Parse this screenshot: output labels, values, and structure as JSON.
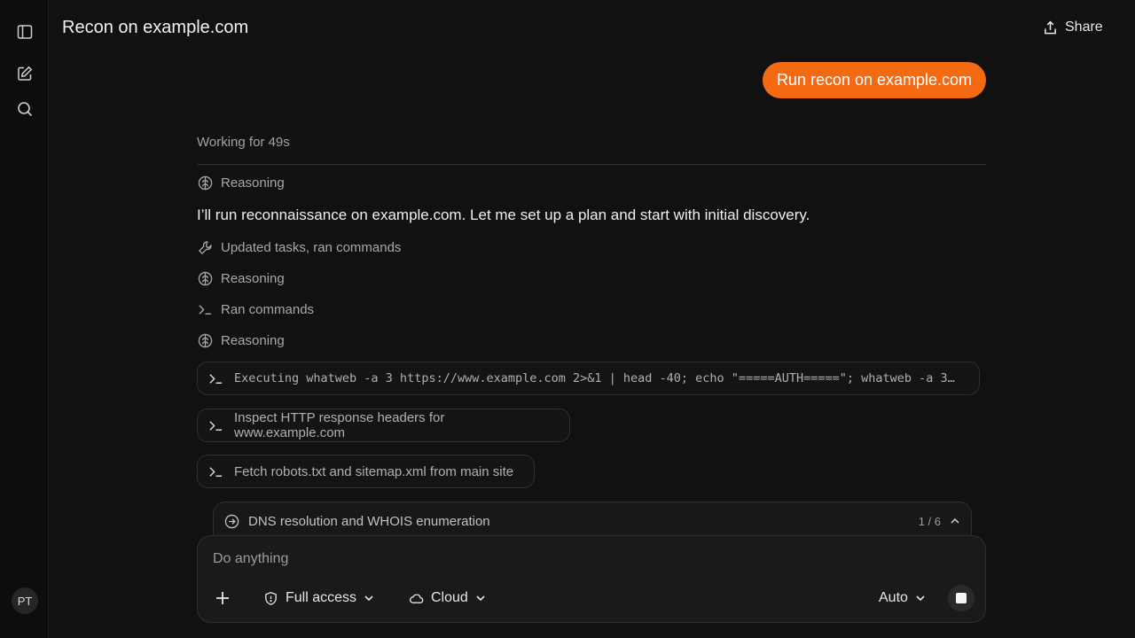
{
  "header": {
    "title": "Recon on example.com",
    "share_label": "Share"
  },
  "sidebar": {
    "avatar_initials": "PT",
    "icons": [
      "sidebar-toggle-icon",
      "new-chat-icon",
      "search-icon"
    ]
  },
  "conversation": {
    "user_message": "Run recon on example.com",
    "working_status": "Working for 49s",
    "reasoning_label_1": "Reasoning",
    "assistant_text": "I’ll run reconnaissance on example.com. Let me set up a plan and start with initial discovery.",
    "step_updated": "Updated tasks, ran commands",
    "reasoning_label_2": "Reasoning",
    "step_ran": "Ran commands",
    "reasoning_label_3": "Reasoning",
    "commands": [
      "Executing whatweb -a 3 https://www.example.com 2>&1 | head -40; echo \"=====AUTH=====\"; whatweb -a 3…",
      "Inspect HTTP response headers for www.example.com",
      "Fetch robots.txt and sitemap.xml from main site"
    ]
  },
  "task_panel": {
    "label": "DNS resolution and WHOIS enumeration",
    "progress": "1 / 6"
  },
  "composer": {
    "placeholder": "Do anything",
    "access_label": "Full access",
    "env_label": "Cloud",
    "model_label": "Auto"
  },
  "colors": {
    "accent": "#f46a12",
    "background": "#111111"
  }
}
